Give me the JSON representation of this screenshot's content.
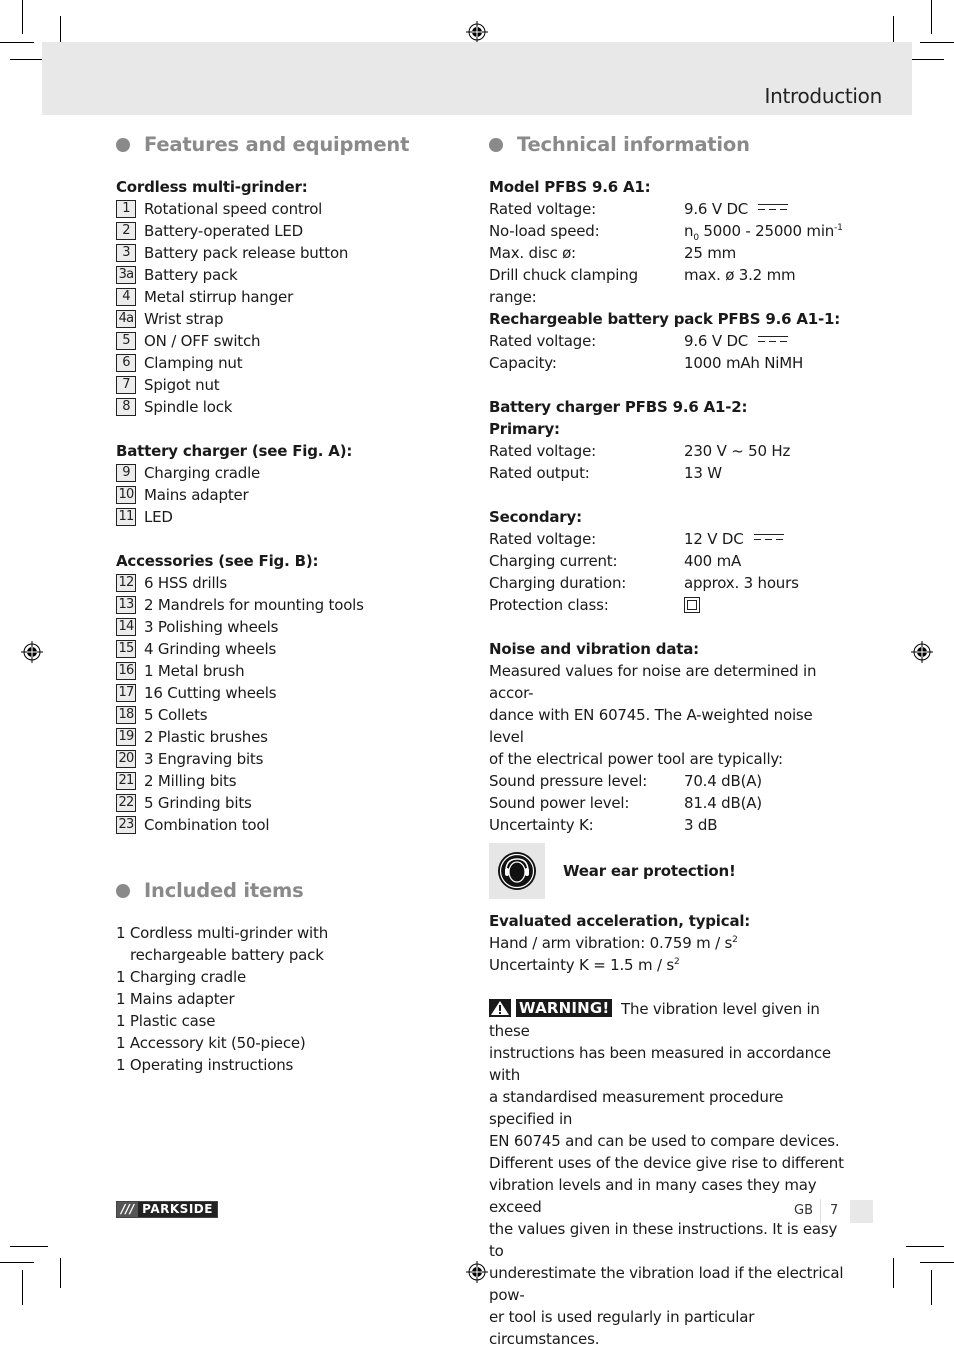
{
  "header": {
    "title": "Introduction"
  },
  "features": {
    "section_title": "Features and equipment",
    "grinder": {
      "heading": "Cordless multi-grinder:",
      "items": [
        {
          "num": "1",
          "label": "Rotational speed control"
        },
        {
          "num": "2",
          "label": "Battery-operated LED"
        },
        {
          "num": "3",
          "label": "Battery pack release button"
        },
        {
          "num": "3a",
          "label": "Battery pack"
        },
        {
          "num": "4",
          "label": "Metal stirrup hanger"
        },
        {
          "num": "4a",
          "label": "Wrist strap"
        },
        {
          "num": "5",
          "label": "ON / OFF switch"
        },
        {
          "num": "6",
          "label": "Clamping nut"
        },
        {
          "num": "7",
          "label": "Spigot nut"
        },
        {
          "num": "8",
          "label": "Spindle lock"
        }
      ]
    },
    "charger": {
      "heading": "Battery charger (see Fig. A):",
      "items": [
        {
          "num": "9",
          "label": "Charging cradle"
        },
        {
          "num": "10",
          "label": "Mains adapter"
        },
        {
          "num": "11",
          "label": "LED"
        }
      ]
    },
    "accessories": {
      "heading": "Accessories (see Fig. B):",
      "items": [
        {
          "num": "12",
          "label": "6 HSS drills"
        },
        {
          "num": "13",
          "label": "2 Mandrels for mounting tools"
        },
        {
          "num": "14",
          "label": "3 Polishing wheels"
        },
        {
          "num": "15",
          "label": "4 Grinding wheels"
        },
        {
          "num": "16",
          "label": "1 Metal brush"
        },
        {
          "num": "17",
          "label": "16 Cutting wheels"
        },
        {
          "num": "18",
          "label": "5 Collets"
        },
        {
          "num": "19",
          "label": "2 Plastic brushes"
        },
        {
          "num": "20",
          "label": "3 Engraving bits"
        },
        {
          "num": "21",
          "label": "2 Milling bits"
        },
        {
          "num": "22",
          "label": "5 Grinding bits"
        },
        {
          "num": "23",
          "label": "Combination tool"
        }
      ]
    }
  },
  "included": {
    "section_title": "Included items",
    "items": [
      "1 Cordless multi-grinder with rechargeable battery pack",
      "1 Charging cradle",
      "1 Mains adapter",
      "1 Plastic case",
      "1 Accessory kit (50-piece)",
      "1 Operating instructions"
    ]
  },
  "technical": {
    "section_title": "Technical information",
    "model": {
      "heading": "Model PFBS 9.6 A1:",
      "rated_voltage_label": "Rated voltage:",
      "rated_voltage_value": "9.6 V DC",
      "noload_label": "No-load speed:",
      "noload_prefix": "n",
      "noload_sub": "0",
      "noload_value": " 5000 - 25000 min",
      "noload_sup": "-1",
      "disc_label": "Max. disc ø:",
      "disc_value": "25 mm",
      "chuck_label": "Drill chuck clamping range:",
      "chuck_value": "max. ø 3.2 mm"
    },
    "battery": {
      "heading": "Rechargeable battery pack PFBS 9.6 A1-1:",
      "rated_voltage_label": "Rated voltage:",
      "rated_voltage_value": "9.6 V DC",
      "capacity_label": "Capacity:",
      "capacity_value": "1000 mAh NiMH"
    },
    "charger": {
      "heading": "Battery charger PFBS 9.6 A1-2:",
      "primary_heading": "Primary:",
      "primary_voltage_label": "Rated voltage:",
      "primary_voltage_value": "230 V ~ 50 Hz",
      "primary_output_label": "Rated output:",
      "primary_output_value": "13 W",
      "secondary_heading": "Secondary:",
      "secondary_voltage_label": "Rated voltage:",
      "secondary_voltage_value": "12 V DC",
      "current_label": "Charging current:",
      "current_value": "400 mA",
      "duration_label": "Charging duration:",
      "duration_value": "approx. 3 hours",
      "protection_label": "Protection class:"
    },
    "noise": {
      "heading": "Noise and vibration data:",
      "intro_lines": [
        "Measured values for noise are determined in accor-",
        "dance with EN 60745. The A-weighted noise level",
        "of the electrical power tool are typically:"
      ],
      "pressure_label": "Sound pressure level:",
      "pressure_value": "70.4 dB(A)",
      "power_label": "Sound power level:",
      "power_value": "81.4 dB(A)",
      "uncertainty_label": "Uncertainty K:",
      "uncertainty_value": "3 dB"
    },
    "ear_protection": "Wear ear protection!",
    "acceleration": {
      "heading": "Evaluated acceleration, typical:",
      "hand_arm": "Hand / arm vibration: 0.759 m / s",
      "hand_arm_sup": "2",
      "uncertainty": "Uncertainty K = 1.5 m / s",
      "uncertainty_sup": "2"
    },
    "warning": {
      "badge": "WARNING!",
      "first_line": " The vibration level given in these",
      "lines": [
        "instructions has been measured in accordance with",
        "a standardised measurement procedure specified in",
        "EN 60745 and can be used to compare devices.",
        "Different uses of the device give rise to different",
        "vibration levels and in many cases they may exceed",
        "the values given in these instructions. It is easy to",
        "underestimate the vibration load if the electrical pow-",
        "er tool is used regularly in particular circumstances."
      ]
    }
  },
  "footer": {
    "logo_slashes": "///",
    "logo_brand": "PARKSIDE",
    "language": "GB",
    "page_number": "7"
  }
}
